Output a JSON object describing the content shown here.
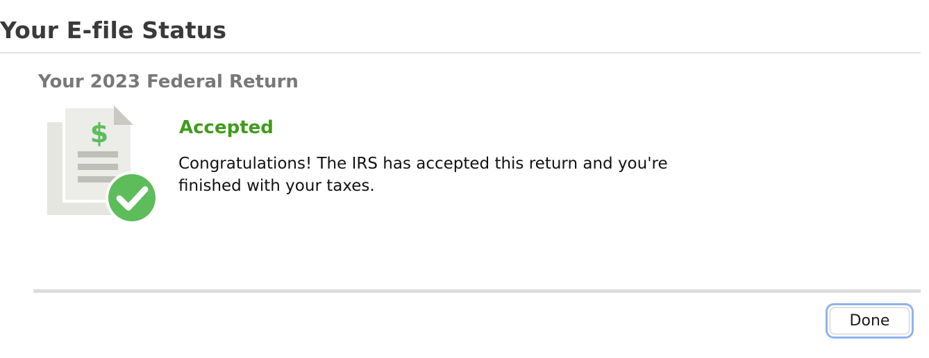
{
  "header": {
    "title": "Your E-file Status"
  },
  "return_card": {
    "title": "Your 2023 Federal Return",
    "status_label": "Accepted",
    "message": "Congratulations! The IRS has accepted this return and you're finished with your taxes.",
    "illustration": {
      "icons": [
        "tax-document-icon",
        "dollar-sign-icon",
        "checkmark-badge-icon"
      ],
      "symbol": "$"
    }
  },
  "footer": {
    "done_label": "Done"
  },
  "colors": {
    "accepted_green": "#3f9c1a",
    "badge_green": "#5cbd5a",
    "document_gray": "#e8e8e3",
    "focus_ring_blue": "#8fb2f3"
  }
}
